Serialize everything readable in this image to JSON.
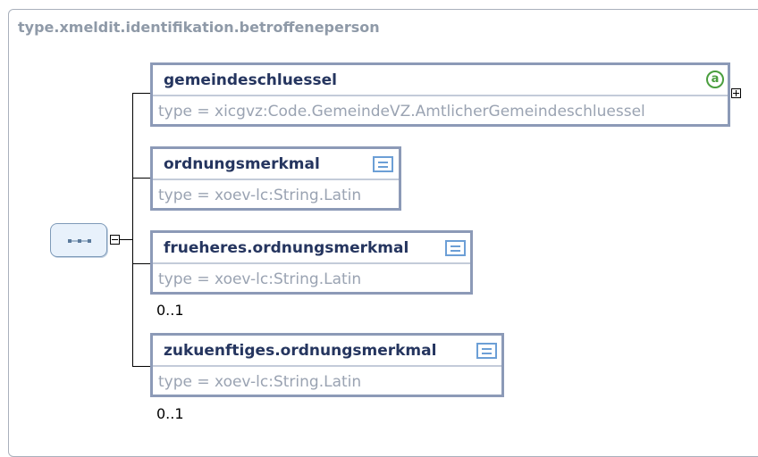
{
  "diagram": {
    "title": "type.xmeldit.identifikation.betroffeneperson",
    "elements": [
      {
        "name": "gemeindeschluessel",
        "type": "type = xicgvz:Code.GemeindeVZ.AmtlicherGemeindeschluessel",
        "occurrence": "",
        "icon": "attribute-icon",
        "icon_glyph": "a"
      },
      {
        "name": "ordnungsmerkmal",
        "type": "type = xoev-lc:String.Latin",
        "occurrence": "",
        "icon": "documentation-icon"
      },
      {
        "name": "frueheres.ordnungsmerkmal",
        "type": "type = xoev-lc:String.Latin",
        "occurrence": "0..1",
        "icon": "documentation-icon"
      },
      {
        "name": "zukuenftiges.ordnungsmerkmal",
        "type": "type = xoev-lc:String.Latin",
        "occurrence": "0..1",
        "icon": "documentation-icon"
      }
    ],
    "compositor": "sequence",
    "colors": {
      "border": "#8c9ab7",
      "name": "#25355f",
      "type": "#9aa3b2",
      "attribute": "#4a9e3e",
      "documentation": "#6c9fd6"
    }
  }
}
